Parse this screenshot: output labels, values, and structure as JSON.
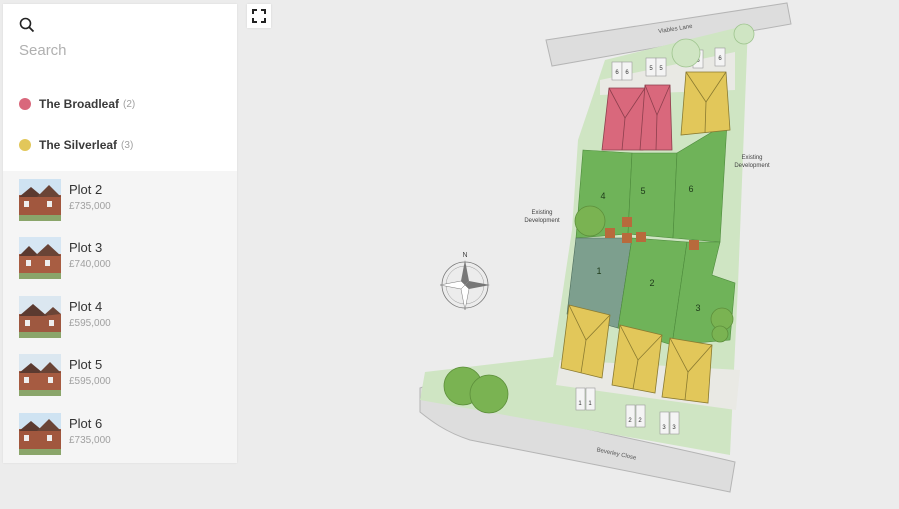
{
  "search": {
    "placeholder": "Search",
    "value": ""
  },
  "legend": [
    {
      "name": "The Broadleaf",
      "count": "(2)",
      "color": "#d9687c"
    },
    {
      "name": "The Silverleaf",
      "count": "(3)",
      "color": "#e2c75a"
    }
  ],
  "plots": [
    {
      "name": "Plot 2",
      "price": "£735,000"
    },
    {
      "name": "Plot 3",
      "price": "£740,000"
    },
    {
      "name": "Plot 4",
      "price": "£595,000"
    },
    {
      "name": "Plot 5",
      "price": "£595,000"
    },
    {
      "name": "Plot 6",
      "price": "£735,000"
    }
  ],
  "map": {
    "roads": {
      "top": "Viables Lane",
      "bottom": "Beverley Close"
    },
    "existing_labels": [
      "Existing",
      "Development"
    ],
    "compass": "N",
    "plot_numbers": [
      "1",
      "2",
      "3",
      "4",
      "5",
      "6"
    ],
    "parking_top": [
      "6",
      "6",
      "5",
      "5",
      "6",
      "6"
    ],
    "parking_bottom": [
      "1",
      "1",
      "2",
      "2",
      "3",
      "3"
    ],
    "colors": {
      "background": "#ececec",
      "verge": "#cfe5c3",
      "garden": "#6fb359",
      "sold_plot": "#7d9f8e",
      "road": "#dddddd",
      "tree": "#7ab352",
      "broadleaf_roof": "#d9687c",
      "silverleaf_roof": "#e2c75a"
    }
  }
}
